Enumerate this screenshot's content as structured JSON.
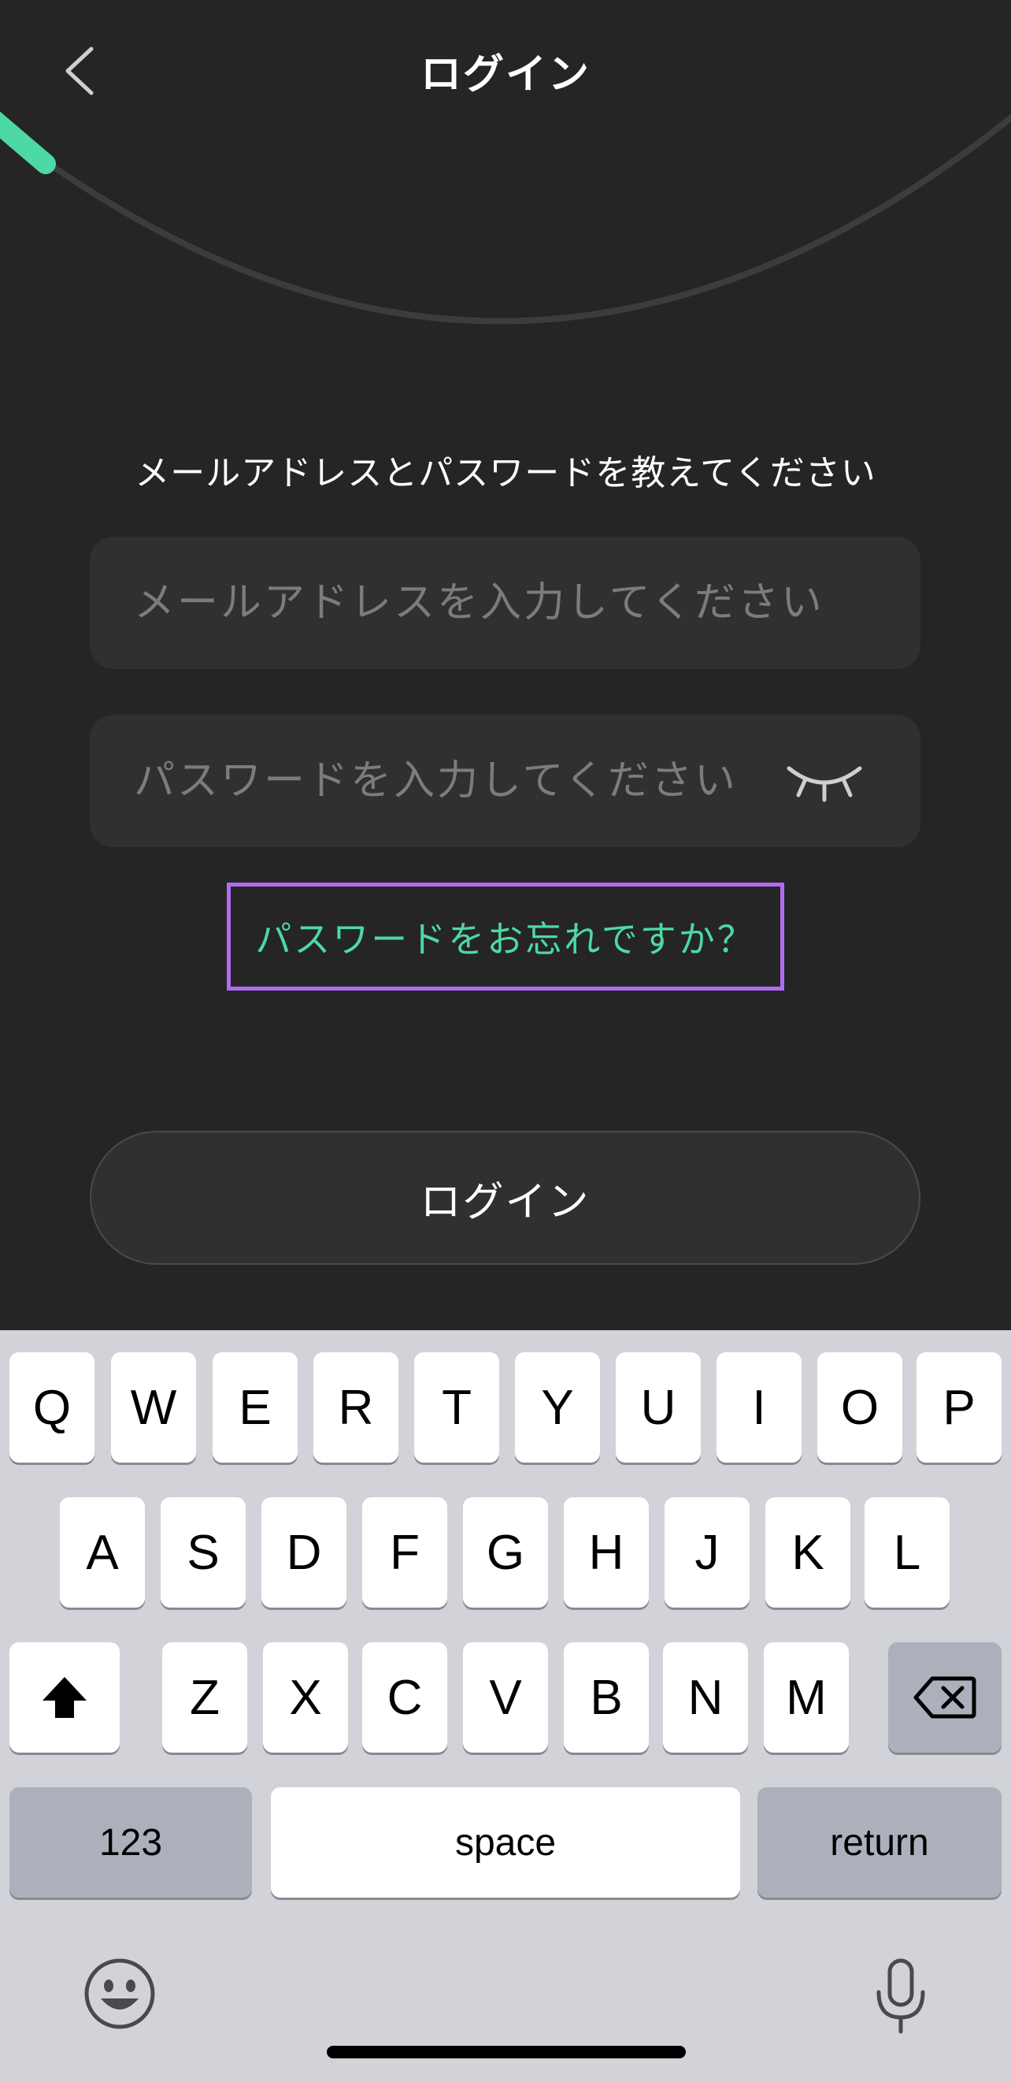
{
  "header": {
    "title": "ログイン"
  },
  "form": {
    "prompt": "メールアドレスとパスワードを教えてください",
    "email_placeholder": "メールアドレスを入力してください",
    "password_placeholder": "パスワードを入力してください",
    "forgot_label": "パスワードをお忘れですか？",
    "login_label": "ログイン"
  },
  "keyboard": {
    "row1": [
      "Q",
      "W",
      "E",
      "R",
      "T",
      "Y",
      "U",
      "I",
      "O",
      "P"
    ],
    "row2": [
      "A",
      "S",
      "D",
      "F",
      "G",
      "H",
      "J",
      "K",
      "L"
    ],
    "row3": [
      "Z",
      "X",
      "C",
      "V",
      "B",
      "N",
      "M"
    ],
    "numbers_label": "123",
    "space_label": "space",
    "return_label": "return"
  },
  "icons": {
    "back": "chevron-left-icon",
    "password_toggle": "eye-closed-icon",
    "shift": "shift-icon",
    "delete": "backspace-icon",
    "emoji": "emoji-icon",
    "dictation": "microphone-icon"
  },
  "colors": {
    "background": "#252525",
    "field": "#303030",
    "accent": "#4cd9a4",
    "highlight": "#b06cf0",
    "keyboard": "#d2d3d9"
  }
}
